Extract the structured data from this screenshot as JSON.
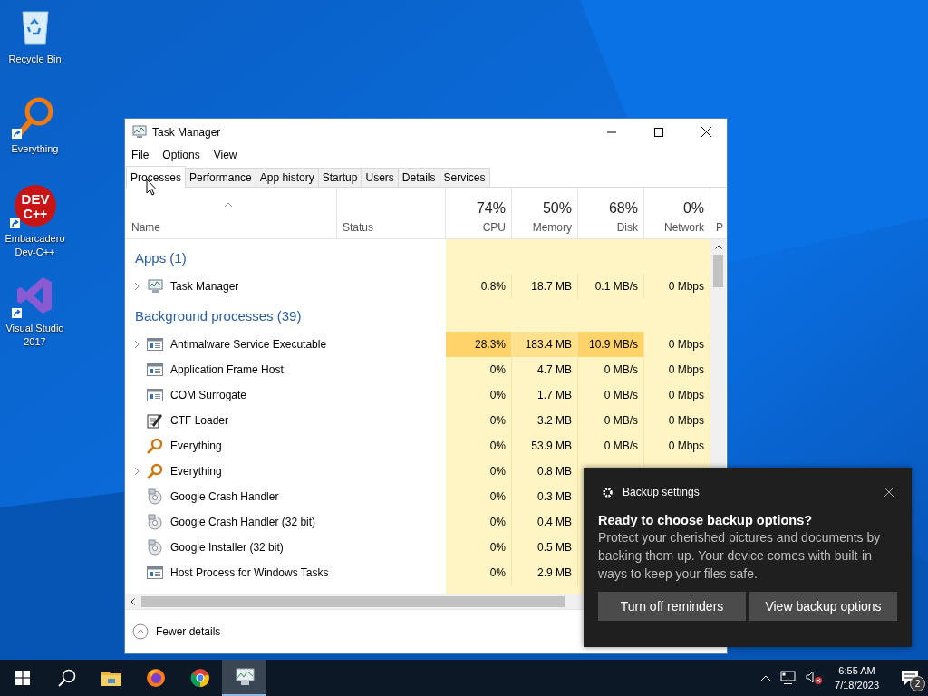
{
  "desktop_icons": [
    {
      "label": "Recycle Bin",
      "kind": "recycle",
      "shortcut": false
    },
    {
      "label": "Everything",
      "kind": "everything",
      "shortcut": true
    },
    {
      "label": "Embarcadero Dev-C++",
      "kind": "devcpp",
      "shortcut": true,
      "logo_text": [
        "DEV",
        "C++"
      ]
    },
    {
      "label": "Visual Studio 2017",
      "kind": "vs",
      "shortcut": true
    }
  ],
  "window": {
    "title": "Task Manager",
    "menu": [
      "File",
      "Options",
      "View"
    ],
    "tabs": [
      {
        "label": "Processes",
        "selected": true
      },
      {
        "label": "Performance",
        "selected": false
      },
      {
        "label": "App history",
        "selected": false
      },
      {
        "label": "Startup",
        "selected": false
      },
      {
        "label": "Users",
        "selected": false
      },
      {
        "label": "Details",
        "selected": false
      },
      {
        "label": "Services",
        "selected": false
      }
    ],
    "name_column": "Name",
    "status_column": "Status",
    "metrics": [
      {
        "total": "74%",
        "label": "CPU"
      },
      {
        "total": "50%",
        "label": "Memory"
      },
      {
        "total": "68%",
        "label": "Disk"
      },
      {
        "total": "0%",
        "label": "Network"
      }
    ],
    "cut_column": "P",
    "groups": [
      {
        "title": "Apps (1)",
        "rows": [
          {
            "name": "Task Manager",
            "kind": "taskmgr",
            "expandable": true,
            "highlighted": false,
            "values": [
              "0.8%",
              "18.7 MB",
              "0.1 MB/s",
              "0 Mbps"
            ]
          }
        ]
      },
      {
        "title": "Background processes (39)",
        "rows": [
          {
            "name": "Antimalware Service Executable",
            "kind": "service",
            "expandable": true,
            "highlighted": true,
            "values": [
              "28.3%",
              "183.4 MB",
              "10.9 MB/s",
              "0 Mbps"
            ]
          },
          {
            "name": "Application Frame Host",
            "kind": "service",
            "expandable": false,
            "highlighted": false,
            "values": [
              "0%",
              "4.7 MB",
              "0 MB/s",
              "0 Mbps"
            ]
          },
          {
            "name": "COM Surrogate",
            "kind": "service",
            "expandable": false,
            "highlighted": false,
            "values": [
              "0%",
              "1.7 MB",
              "0 MB/s",
              "0 Mbps"
            ]
          },
          {
            "name": "CTF Loader",
            "kind": "ctf",
            "expandable": false,
            "highlighted": false,
            "values": [
              "0%",
              "3.2 MB",
              "0 MB/s",
              "0 Mbps"
            ]
          },
          {
            "name": "Everything",
            "kind": "everything",
            "expandable": false,
            "highlighted": false,
            "values": [
              "0%",
              "53.9 MB",
              "0 MB/s",
              "0 Mbps"
            ]
          },
          {
            "name": "Everything",
            "kind": "everything",
            "expandable": true,
            "highlighted": false,
            "values": [
              "0%",
              "0.8 MB"
            ]
          },
          {
            "name": "Google Crash Handler",
            "kind": "google",
            "expandable": false,
            "highlighted": false,
            "values": [
              "0%",
              "0.3 MB"
            ]
          },
          {
            "name": "Google Crash Handler (32 bit)",
            "kind": "google",
            "expandable": false,
            "highlighted": false,
            "values": [
              "0%",
              "0.4 MB"
            ]
          },
          {
            "name": "Google Installer (32 bit)",
            "kind": "google",
            "expandable": false,
            "highlighted": false,
            "values": [
              "0%",
              "0.5 MB"
            ]
          },
          {
            "name": "Host Process for Windows Tasks",
            "kind": "service",
            "expandable": false,
            "highlighted": false,
            "values": [
              "0%",
              "2.9 MB"
            ]
          }
        ]
      }
    ],
    "footer": "Fewer details"
  },
  "notification": {
    "app": "Backup settings",
    "title": "Ready to choose backup options?",
    "body": "Protect your cherished pictures and documents by backing them up. Your device comes with built-in ways to keep your files safe.",
    "buttons": [
      "Turn off reminders",
      "View backup options"
    ]
  },
  "taskbar": {
    "apps": [
      {
        "kind": "start",
        "running": false
      },
      {
        "kind": "search",
        "running": false
      },
      {
        "kind": "folder",
        "running": false
      },
      {
        "kind": "firefox",
        "running": false
      },
      {
        "kind": "chrome",
        "running": false
      },
      {
        "kind": "taskmgr",
        "running": true
      }
    ],
    "time": "6:55 AM",
    "date": "7/18/2023",
    "notification_count": "2"
  }
}
